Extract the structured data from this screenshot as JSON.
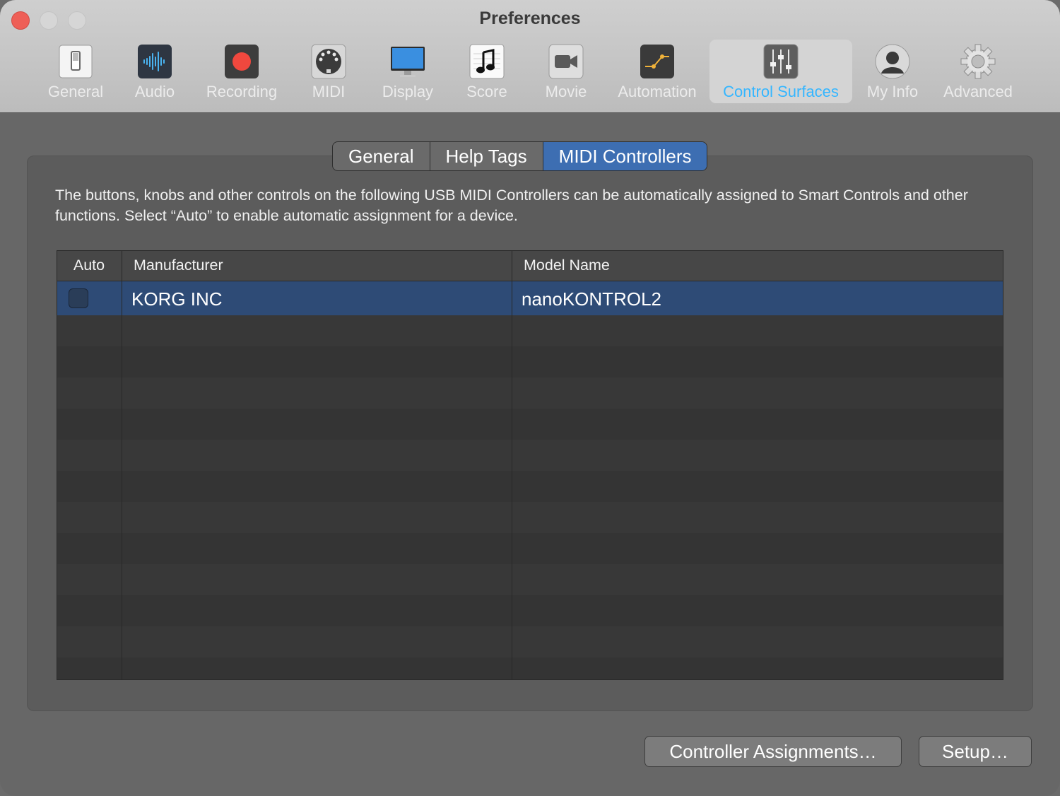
{
  "window": {
    "title": "Preferences"
  },
  "toolbar": {
    "items": [
      {
        "label": "General",
        "icon": "general-switch-icon"
      },
      {
        "label": "Audio",
        "icon": "audio-waveform-icon"
      },
      {
        "label": "Recording",
        "icon": "record-icon"
      },
      {
        "label": "MIDI",
        "icon": "midi-connector-icon"
      },
      {
        "label": "Display",
        "icon": "display-monitor-icon"
      },
      {
        "label": "Score",
        "icon": "music-note-icon"
      },
      {
        "label": "Movie",
        "icon": "video-camera-icon"
      },
      {
        "label": "Automation",
        "icon": "automation-curve-icon"
      },
      {
        "label": "Control Surfaces",
        "icon": "faders-icon",
        "selected": true
      },
      {
        "label": "My Info",
        "icon": "user-silhouette-icon"
      },
      {
        "label": "Advanced",
        "icon": "gear-icon"
      }
    ]
  },
  "tabs": [
    {
      "label": "General"
    },
    {
      "label": "Help Tags"
    },
    {
      "label": "MIDI Controllers",
      "active": true
    }
  ],
  "description": "The buttons, knobs and other controls on the following USB MIDI Controllers can be automatically assigned to Smart Controls and other functions. Select “Auto” to enable automatic assignment for a device.",
  "table": {
    "columns": [
      "Auto",
      "Manufacturer",
      "Model Name"
    ],
    "rows": [
      {
        "auto": false,
        "manufacturer": "KORG INC",
        "model": "nanoKONTROL2",
        "selected": true
      }
    ]
  },
  "buttons": {
    "controller_assignments": "Controller Assignments…",
    "setup": "Setup…"
  },
  "colors": {
    "accent": "#3d6eb2",
    "selected_toolbar_label": "#35b6ff",
    "row_selection": "#2e4b76"
  }
}
